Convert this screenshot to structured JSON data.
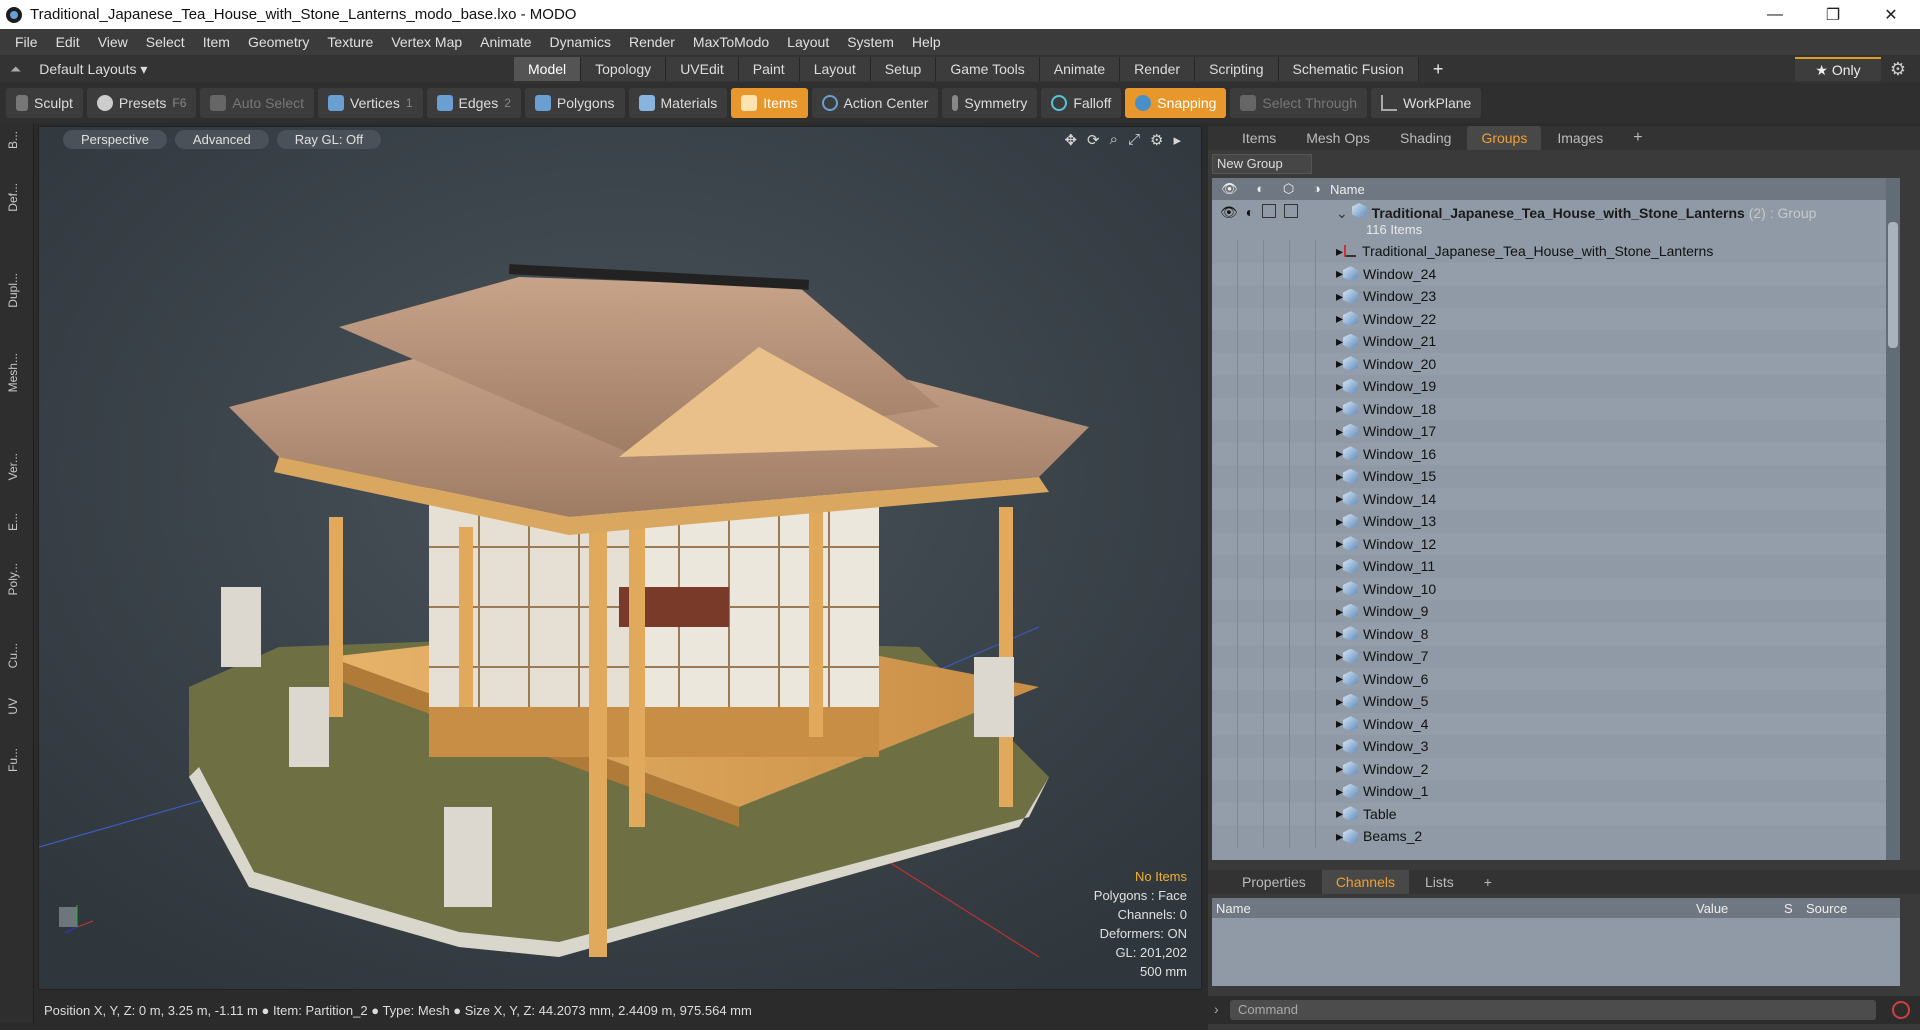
{
  "window": {
    "title": "Traditional_Japanese_Tea_House_with_Stone_Lanterns_modo_base.lxo - MODO",
    "minimize": "—",
    "maximize": "❐",
    "close": "✕"
  },
  "menu": [
    "File",
    "Edit",
    "View",
    "Select",
    "Item",
    "Geometry",
    "Texture",
    "Vertex Map",
    "Animate",
    "Dynamics",
    "Render",
    "MaxToModo",
    "Layout",
    "System",
    "Help"
  ],
  "layout_selector": "Default Layouts ▾",
  "tabs": [
    "Model",
    "Topology",
    "UVEdit",
    "Paint",
    "Layout",
    "Setup",
    "Game Tools",
    "Animate",
    "Render",
    "Scripting",
    "Schematic Fusion"
  ],
  "active_tab": "Model",
  "only_label": "★  Only",
  "toolbar": {
    "sculpt": "Sculpt",
    "presets": "Presets",
    "presets_key": "F6",
    "auto_select": "Auto Select",
    "vertices": "Vertices",
    "vertices_count": "1",
    "edges": "Edges",
    "edges_count": "2",
    "polygons": "Polygons",
    "materials": "Materials",
    "items": "Items",
    "action_center": "Action Center",
    "symmetry": "Symmetry",
    "falloff": "Falloff",
    "snapping": "Snapping",
    "select_through": "Select Through",
    "workplane": "WorkPlane"
  },
  "left_tabs": [
    "B...",
    "Def...",
    "Dupl...",
    "Mesh...",
    "Ver...",
    "E...",
    "Poly...",
    "Cu...",
    "UV",
    "Fu..."
  ],
  "viewport": {
    "view": "Perspective",
    "shading": "Advanced",
    "raygl": "Ray GL: Off",
    "stats": {
      "no_items": "No Items",
      "polygons": "Polygons : Face",
      "channels": "Channels: 0",
      "deformers": "Deformers: ON",
      "gl": "GL: 201,202",
      "scale": "500 mm"
    }
  },
  "status": "Position X, Y, Z:   0 m, 3.25 m, -1.11 m  ●  Item:  Partition_2  ●  Type:  Mesh  ●  Size X, Y, Z:   44.2073 mm, 2.4409 m, 975.564 mm",
  "panel": {
    "tabs": [
      "Items",
      "Mesh Ops",
      "Shading",
      "Groups",
      "Images"
    ],
    "active": "Groups",
    "new_group": "New Group",
    "name_header": "Name",
    "group": {
      "name": "Traditional_Japanese_Tea_House_with_Stone_Lanterns",
      "tag": "(2) : Group",
      "count": "116 Items"
    },
    "items": [
      {
        "name": "Traditional_Japanese_Tea_House_with_Stone_Lanterns",
        "icon": "locator-icon"
      },
      {
        "name": "Window_24",
        "icon": "mesh-icon"
      },
      {
        "name": "Window_23",
        "icon": "mesh-icon"
      },
      {
        "name": "Window_22",
        "icon": "mesh-icon"
      },
      {
        "name": "Window_21",
        "icon": "mesh-icon"
      },
      {
        "name": "Window_20",
        "icon": "mesh-icon"
      },
      {
        "name": "Window_19",
        "icon": "mesh-icon"
      },
      {
        "name": "Window_18",
        "icon": "mesh-icon"
      },
      {
        "name": "Window_17",
        "icon": "mesh-icon"
      },
      {
        "name": "Window_16",
        "icon": "mesh-icon"
      },
      {
        "name": "Window_15",
        "icon": "mesh-icon"
      },
      {
        "name": "Window_14",
        "icon": "mesh-icon"
      },
      {
        "name": "Window_13",
        "icon": "mesh-icon"
      },
      {
        "name": "Window_12",
        "icon": "mesh-icon"
      },
      {
        "name": "Window_11",
        "icon": "mesh-icon"
      },
      {
        "name": "Window_10",
        "icon": "mesh-icon"
      },
      {
        "name": "Window_9",
        "icon": "mesh-icon"
      },
      {
        "name": "Window_8",
        "icon": "mesh-icon"
      },
      {
        "name": "Window_7",
        "icon": "mesh-icon"
      },
      {
        "name": "Window_6",
        "icon": "mesh-icon"
      },
      {
        "name": "Window_5",
        "icon": "mesh-icon"
      },
      {
        "name": "Window_4",
        "icon": "mesh-icon"
      },
      {
        "name": "Window_3",
        "icon": "mesh-icon"
      },
      {
        "name": "Window_2",
        "icon": "mesh-icon"
      },
      {
        "name": "Window_1",
        "icon": "mesh-icon"
      },
      {
        "name": "Table",
        "icon": "mesh-icon"
      },
      {
        "name": "Beams_2",
        "icon": "mesh-icon"
      }
    ]
  },
  "bottom_panel": {
    "tabs": [
      "Properties",
      "Channels",
      "Lists"
    ],
    "active": "Channels",
    "columns": [
      "Name",
      "Value",
      "S",
      "Source"
    ]
  },
  "command_placeholder": "Command",
  "colors": {
    "accent": "#e8972a",
    "viewport_bg": "#394148",
    "tree_bg": "#8f9aa6"
  }
}
